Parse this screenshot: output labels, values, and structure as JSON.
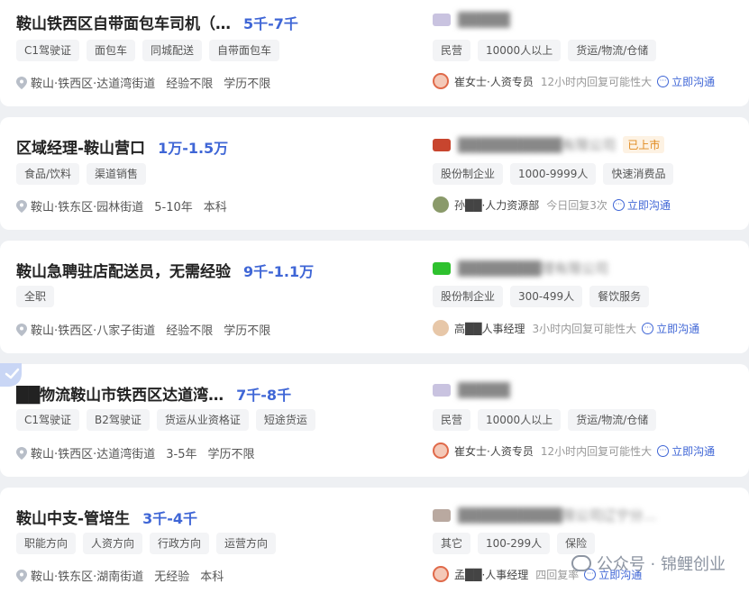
{
  "jobs": [
    {
      "title": "鞍山铁西区自带面包车司机（…",
      "salary": "5千-7千",
      "tags": [
        "C1驾驶证",
        "面包车",
        "同城配送",
        "自带面包车"
      ],
      "location": "鞍山·铁西区·达道湾街道",
      "experience": "经验不限",
      "education": "学历不限",
      "company": {
        "name": "█████",
        "listed": "",
        "tags": [
          "民营",
          "10000人以上",
          "货运/物流/仓储"
        ],
        "recruiter": "崔女士·人资专员",
        "reply": "12小时内回复可能性大",
        "chat": "立即沟通"
      }
    },
    {
      "title": "区域经理-鞍山营口",
      "salary": "1万-1.5万",
      "tags": [
        "食品/饮料",
        "渠道销售"
      ],
      "location": "鞍山·铁东区·园林街道",
      "experience": "5-10年",
      "education": "本科",
      "company": {
        "name": "██████████有限公司",
        "listed": "已上市",
        "tags": [
          "股份制企业",
          "1000-9999人",
          "快速消费品"
        ],
        "recruiter": "孙██·人力资源部",
        "reply": "今日回复3次",
        "chat": "立即沟通"
      }
    },
    {
      "title": "鞍山急聘驻店配送员，无需经验",
      "salary": "9千-1.1万",
      "tags": [
        "全职"
      ],
      "location": "鞍山·铁西区·八家子街道",
      "experience": "经验不限",
      "education": "学历不限",
      "company": {
        "name": "████████理有限公司",
        "listed": "",
        "tags": [
          "股份制企业",
          "300-499人",
          "餐饮服务"
        ],
        "recruiter": "高██人事经理",
        "reply": "3小时内回复可能性大",
        "chat": "立即沟通"
      }
    },
    {
      "title": "██物流鞍山市铁西区达道湾…",
      "salary": "7千-8千",
      "tags": [
        "C1驾驶证",
        "B2驾驶证",
        "货运从业资格证",
        "短途货运"
      ],
      "location": "鞍山·铁西区·达道湾街道",
      "experience": "3-5年",
      "education": "学历不限",
      "company": {
        "name": "█████",
        "listed": "",
        "tags": [
          "民营",
          "10000人以上",
          "货运/物流/仓储"
        ],
        "recruiter": "崔女士·人资专员",
        "reply": "12小时内回复可能性大",
        "chat": "立即沟通"
      }
    },
    {
      "title": "鞍山中支-管培生",
      "salary": "3千-4千",
      "tags": [
        "职能方向",
        "人资方向",
        "行政方向",
        "运营方向"
      ],
      "location": "鞍山·铁东区·湖南街道",
      "experience": "无经验",
      "education": "本科",
      "company": {
        "name": "██████████限公司辽宁分…",
        "listed": "",
        "tags": [
          "其它",
          "100-299人",
          "保险"
        ],
        "recruiter": "孟██·人事经理",
        "reply": "四回复率",
        "chat": "立即沟通"
      }
    }
  ],
  "watermark": "公众号 · 锦鲤创业",
  "colors": {
    "salary": "#3f66d6",
    "accent": "#3f66d6",
    "listed": "#e08a1f"
  }
}
